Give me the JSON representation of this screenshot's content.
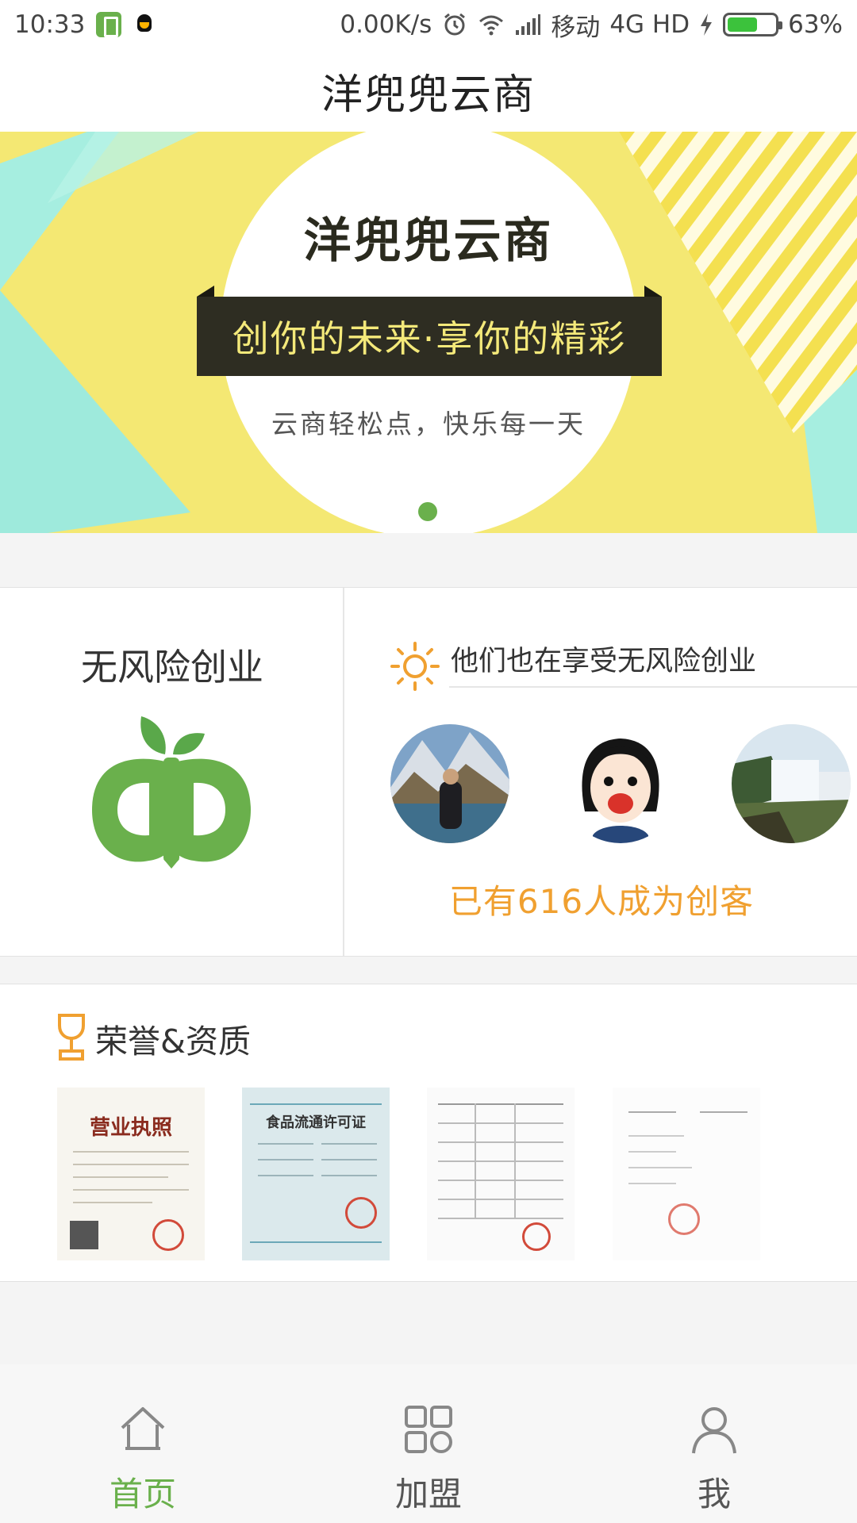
{
  "status_bar": {
    "time": "10:33",
    "network_speed": "0.00K/s",
    "carrier": "移动",
    "network_type": "4G HD",
    "battery_percent": "63%",
    "battery_level": 0.63
  },
  "header": {
    "title": "洋兜兜云商"
  },
  "banner": {
    "title": "洋兜兜云商",
    "slogan": "创你的未来·享你的精彩",
    "subtitle": "云商轻松点，快乐每一天",
    "page_count": 1,
    "active_page": 1
  },
  "risk_free": {
    "title": "无风险创业",
    "enjoy_heading": "他们也在享受无风险创业",
    "count_text": "已有616人成为创客",
    "avatars": [
      "avatar-mountain-lake",
      "avatar-cartoon-girl",
      "avatar-waterfall"
    ]
  },
  "honor": {
    "title": "荣誉&资质",
    "certificates": [
      {
        "name": "business-license",
        "heading": "营业执照"
      },
      {
        "name": "food-circulation-permit",
        "heading": "食品流通许可证"
      },
      {
        "name": "registration-form",
        "heading": ""
      },
      {
        "name": "filing-certificate",
        "heading": ""
      }
    ]
  },
  "tabs": [
    {
      "id": "home",
      "label": "首页",
      "icon": "home-icon",
      "active": true
    },
    {
      "id": "join",
      "label": "加盟",
      "icon": "grid-icon",
      "active": false
    },
    {
      "id": "me",
      "label": "我",
      "icon": "user-icon",
      "active": false
    }
  ],
  "colors": {
    "accent_green": "#6ab04c",
    "count_orange": "#f0a030",
    "banner_yellow": "#f4e873",
    "banner_teal": "#8de8d8"
  }
}
